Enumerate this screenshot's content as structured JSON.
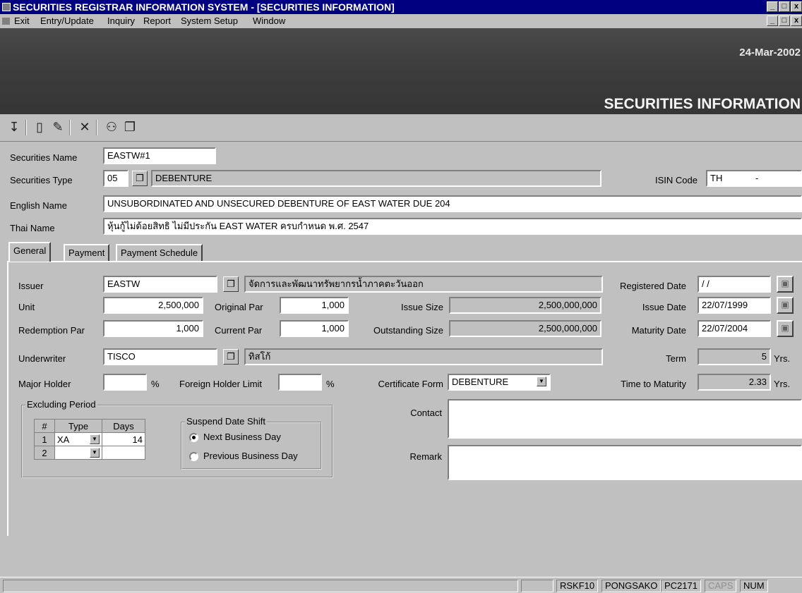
{
  "window": {
    "title": "SECURITIES REGISTRAR INFORMATION SYSTEM - [SECURITIES INFORMATION]",
    "buttons": [
      "_",
      "ə",
      "X"
    ]
  },
  "menu": [
    "Exit",
    "Entry/Update",
    "Inquiry",
    "Report",
    "System Setup",
    "Window"
  ],
  "banner": {
    "date": "24-Mar-2002",
    "title": "SECURITIES INFORMATION"
  },
  "toolbar": {
    "icons": [
      "exit-icon",
      "new-record-icon",
      "edit-icon",
      "delete-icon",
      "find-icon",
      "lookup-icon"
    ]
  },
  "header": {
    "securities_name_label": "Securities Name",
    "securities_name": "EASTW#1",
    "securities_type_label": "Securities Type",
    "securities_type_code": "05",
    "securities_type_desc": "DEBENTURE",
    "isin_label": "ISIN Code",
    "isin_value": "TH",
    "isin_suffix": "-",
    "english_name_label": "English Name",
    "english_name": "UNSUBORDINATED AND UNSECURED DEBENTURE OF EAST WATER DUE 204",
    "thai_name_label": "Thai Name",
    "thai_name": "หุ้นกู้ไม่ด้อยสิทธิ ไม่มีประกัน EAST WATER ครบกำหนด พ.ศ. 2547"
  },
  "tabs": [
    "General",
    "Payment",
    "Payment Schedule"
  ],
  "general": {
    "issuer_label": "Issuer",
    "issuer_code": "EASTW",
    "issuer_name": "จัดการและพัฒนาทรัพยากรน้ำภาคตะวันออก",
    "unit_label": "Unit",
    "unit": "2,500,000",
    "original_par_label": "Original Par",
    "original_par": "1,000",
    "issue_size_label": "Issue Size",
    "issue_size": "2,500,000,000",
    "redemption_par_label": "Redemption Par",
    "redemption_par": "1,000",
    "current_par_label": "Current Par",
    "current_par": "1,000",
    "outstanding_size_label": "Outstanding Size",
    "outstanding_size": "2,500,000,000",
    "underwriter_label": "Underwriter",
    "underwriter_code": "TISCO",
    "underwriter_name": "ทิสโก้",
    "major_holder_label": "Major Holder",
    "major_holder": "",
    "pct": "%",
    "foreign_limit_label": "Foreign Holder Limit",
    "foreign_limit": "",
    "certificate_form_label": "Certificate Form",
    "certificate_form": "DEBENTURE",
    "registered_date_label": "Registered Date",
    "registered_date": "/ /",
    "issue_date_label": "Issue Date",
    "issue_date": "22/07/1999",
    "maturity_date_label": "Maturity Date",
    "maturity_date": "22/07/2004",
    "term_label": "Term",
    "term": "5",
    "time_to_maturity_label": "Time to Maturity",
    "time_to_maturity": "2.33",
    "yrs": "Yrs.",
    "contact_label": "Contact",
    "contact": "",
    "remark_label": "Remark",
    "remark": ""
  },
  "excluding_period": {
    "title": "Excluding Period",
    "columns": [
      "#",
      "Type",
      "Days"
    ],
    "rows": [
      {
        "no": "1",
        "type": "XA",
        "days": "14"
      },
      {
        "no": "2",
        "type": "",
        "days": ""
      }
    ]
  },
  "suspend_date_shift": {
    "title": "Suspend Date Shift",
    "options": [
      "Next Business Day",
      "Previous Business Day"
    ],
    "selected": "Next Business Day"
  },
  "status": {
    "panels": [
      "RSKF10",
      "PONGSAKO",
      "PC2171",
      "CAPS",
      "NUM"
    ]
  }
}
